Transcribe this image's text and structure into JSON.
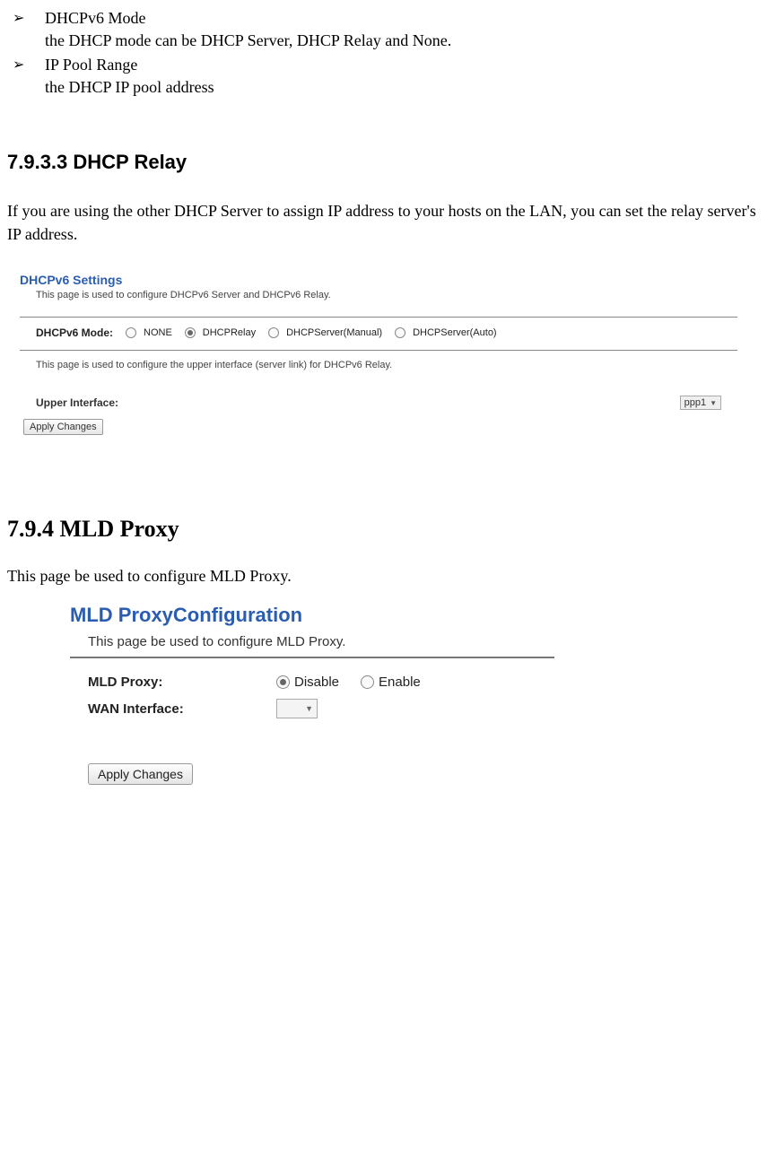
{
  "top_bullets": [
    {
      "title": "DHCPv6 Mode",
      "desc": "the DHCP mode can be DHCP Server, DHCP Relay and None."
    },
    {
      "title": "IP Pool Range",
      "desc": "the DHCP IP pool address"
    }
  ],
  "sec1": {
    "heading": "7.9.3.3 DHCP Relay",
    "body": "If you are using the other DHCP Server to assign IP address to your hosts on the LAN, you can set the relay server's IP address."
  },
  "shot1": {
    "title": "DHCPv6 Settings",
    "desc": "This page is used to configure DHCPv6 Server and DHCPv6 Relay.",
    "mode_label": "DHCPv6 Mode:",
    "modes": [
      {
        "label": "NONE",
        "selected": false
      },
      {
        "label": "DHCPRelay",
        "selected": true
      },
      {
        "label": "DHCPServer(Manual)",
        "selected": false
      },
      {
        "label": "DHCPServer(Auto)",
        "selected": false
      }
    ],
    "desc2": "This page is used to configure the upper interface (server link) for DHCPv6 Relay.",
    "upper_label": "Upper Interface:",
    "upper_value": "ppp1",
    "apply": "Apply Changes"
  },
  "sec2": {
    "heading": "7.9.4 MLD Proxy",
    "body": "This page be used to configure MLD Proxy."
  },
  "shot2": {
    "title": "MLD ProxyConfiguration",
    "desc": "This page be used to configure MLD Proxy.",
    "proxy_label": "MLD Proxy:",
    "disable": "Disable",
    "enable": "Enable",
    "wan_label": "WAN Interface:",
    "apply": "Apply Changes"
  }
}
